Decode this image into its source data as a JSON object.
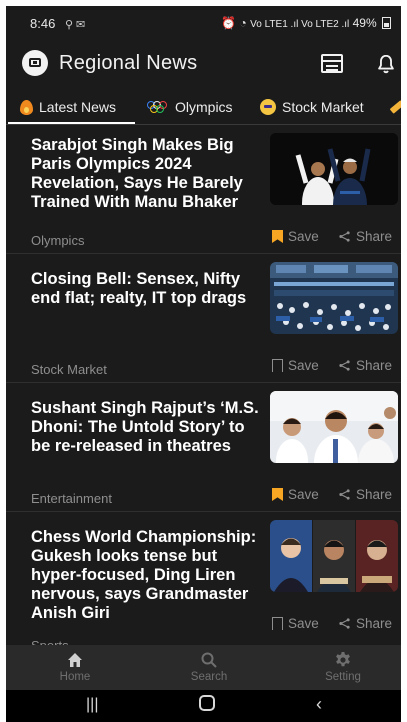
{
  "status_bar": {
    "time": "8:46",
    "indicators": "Vo LTE1 .ıl Vo LTE2 .ıl",
    "battery": "49%"
  },
  "app_bar": {
    "title": "Regional News",
    "logo_icon": "newspaper-icon",
    "actions": [
      "calendar-icon",
      "bell-icon"
    ]
  },
  "tabs": [
    {
      "label": "Latest News",
      "icon": "flame-icon",
      "active": true
    },
    {
      "label": "Olympics",
      "icon": "olympic-rings-icon",
      "active": false
    },
    {
      "label": "Stock Market",
      "icon": "coin-icon",
      "active": false
    },
    {
      "label": "",
      "icon": "pencil-icon",
      "active": false
    }
  ],
  "articles": [
    {
      "headline": "Sarabjot Singh Makes Big Paris Olympics 2024 Revelation, Says He Barely Trained With Manu Bhaker",
      "category": "Olympics",
      "saved": true,
      "save_label": "Save",
      "share_label": "Share",
      "image": "athletes-celebrating-photo"
    },
    {
      "headline": "Closing Bell: Sensex, Nifty end flat; realty, IT top drags",
      "category": "Stock Market",
      "saved": false,
      "save_label": "Save",
      "share_label": "Share",
      "image": "trading-floor-photo"
    },
    {
      "headline": "Sushant Singh Rajput’s ‘M.S. Dhoni: The Untold Story’ to be re-released in theatres",
      "category": "Entertainment",
      "saved": true,
      "save_label": "Save",
      "share_label": "Share",
      "image": "actor-classroom-photo"
    },
    {
      "headline": "Chess World Championship: Gukesh looks tense but hyper-focused, Ding Liren nervous, says Grandmaster Anish Giri",
      "category": "Sports",
      "saved": false,
      "save_label": "Save",
      "share_label": "Share",
      "image": "chess-players-photo"
    }
  ],
  "bottom_nav": [
    {
      "label": "Home",
      "icon": "home-icon",
      "active": true
    },
    {
      "label": "Search",
      "icon": "search-icon",
      "active": false
    },
    {
      "label": "Setting",
      "icon": "gear-icon",
      "active": false
    }
  ],
  "colors": {
    "background": "#1b1b1b",
    "saved_accent": "#f6a623",
    "muted_text": "#8e8e8e",
    "nav_bar": "#2a2a2a"
  }
}
